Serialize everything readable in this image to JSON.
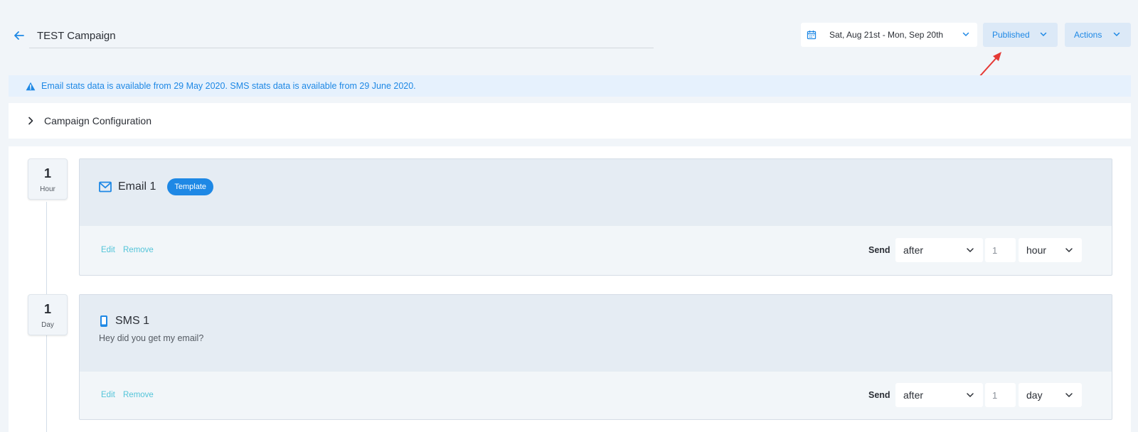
{
  "header": {
    "title": "TEST Campaign",
    "date_range": "Sat, Aug 21st - Mon, Sep 20th",
    "status_label": "Published",
    "actions_label": "Actions"
  },
  "alert": {
    "text": "Email stats data is available from 29 May 2020. SMS stats data is available from 29 June 2020."
  },
  "config": {
    "label": "Campaign Configuration"
  },
  "steps": [
    {
      "delay_value": "1",
      "delay_unit": "Hour",
      "title": "Email 1",
      "icon": "email-icon",
      "badge": "Template",
      "edit": "Edit",
      "remove": "Remove",
      "send_label": "Send",
      "timing": "after",
      "amount": "1",
      "unit": "hour"
    },
    {
      "delay_value": "1",
      "delay_unit": "Day",
      "title": "SMS 1",
      "icon": "mobile-icon",
      "message": "Hey did you get my email?",
      "edit": "Edit",
      "remove": "Remove",
      "send_label": "Send",
      "timing": "after",
      "amount": "1",
      "unit": "day"
    }
  ],
  "colors": {
    "accent": "#1e88e5",
    "link": "#53c4d9",
    "annotation_arrow": "#e53935"
  }
}
